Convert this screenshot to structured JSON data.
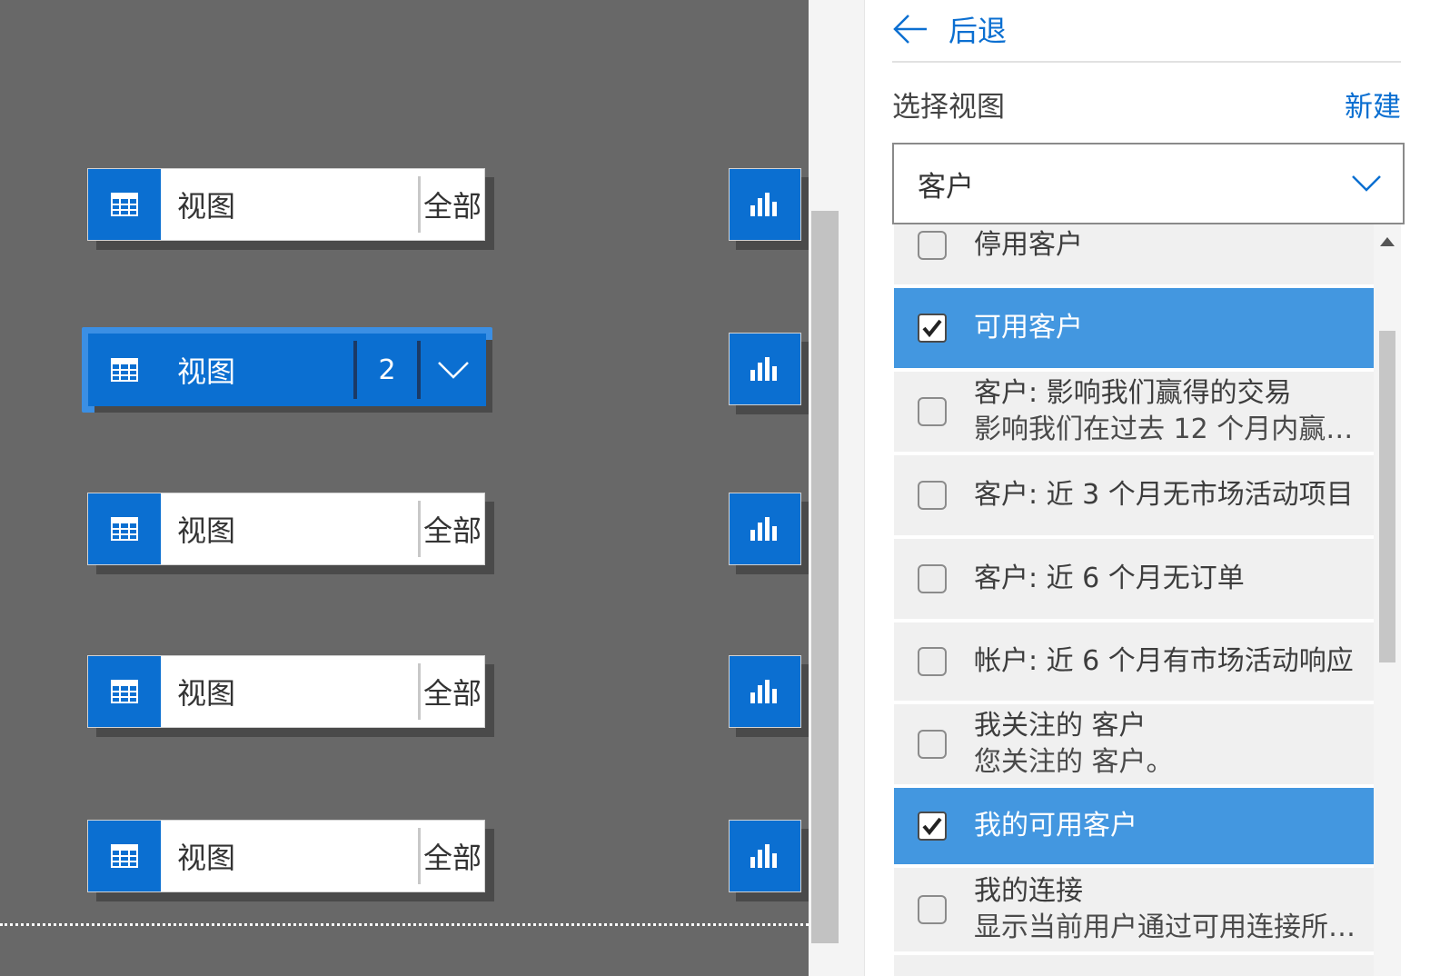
{
  "canvas": {
    "tiles": [
      {
        "label": "视图",
        "filter": "全部"
      },
      {
        "label": "视图",
        "count": "2",
        "selected": true
      },
      {
        "label": "视图",
        "filter": "全部"
      },
      {
        "label": "视图",
        "filter": "全部"
      },
      {
        "label": "视图",
        "filter": "全部"
      }
    ]
  },
  "panel": {
    "back_label": "后退",
    "select_view_label": "选择视图",
    "new_label": "新建",
    "entity_dropdown": {
      "value": "客户"
    },
    "views": [
      {
        "title": "停用客户",
        "checked": false
      },
      {
        "title": "可用客户",
        "checked": true
      },
      {
        "title": "客户: 影响我们赢得的交易",
        "subtitle": "影响我们在过去 12 个月内赢…",
        "checked": false
      },
      {
        "title": "客户: 近 3 个月无市场活动项目",
        "checked": false
      },
      {
        "title": "客户: 近 6 个月无订单",
        "checked": false
      },
      {
        "title": "帐户: 近 6 个月有市场活动响应",
        "checked": false
      },
      {
        "title": "我关注的 客户",
        "subtitle": "您关注的 客户。",
        "checked": false
      },
      {
        "title": "我的可用客户",
        "checked": true
      },
      {
        "title": "我的连接",
        "subtitle": "显示当前用户通过可用连接所…",
        "checked": false
      }
    ]
  },
  "colors": {
    "accent": "#0b6fd1",
    "selected_row": "#4397e0",
    "canvas_bg": "#686868"
  }
}
